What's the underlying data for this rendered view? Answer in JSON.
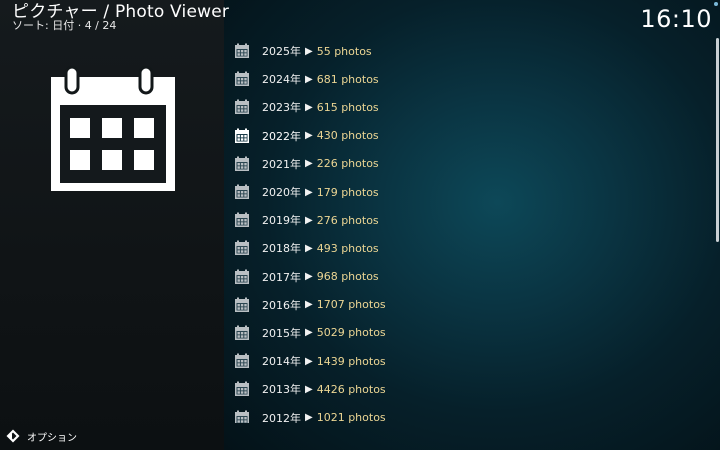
{
  "header": {
    "title": "ピクチャー / Photo Viewer",
    "subtitle": "ソート: 日付 · 4 / 24",
    "clock": "16:10"
  },
  "years": [
    {
      "year": "2025年",
      "arrow": "▶",
      "count": "55 photos"
    },
    {
      "year": "2024年",
      "arrow": "▶",
      "count": "681 photos"
    },
    {
      "year": "2023年",
      "arrow": "▶",
      "count": "615 photos"
    },
    {
      "year": "2022年",
      "arrow": "▶",
      "count": "430 photos",
      "selected": true
    },
    {
      "year": "2021年",
      "arrow": "▶",
      "count": "226 photos"
    },
    {
      "year": "2020年",
      "arrow": "▶",
      "count": "179 photos"
    },
    {
      "year": "2019年",
      "arrow": "▶",
      "count": "276 photos"
    },
    {
      "year": "2018年",
      "arrow": "▶",
      "count": "493 photos"
    },
    {
      "year": "2017年",
      "arrow": "▶",
      "count": "968 photos"
    },
    {
      "year": "2016年",
      "arrow": "▶",
      "count": "1707 photos"
    },
    {
      "year": "2015年",
      "arrow": "▶",
      "count": "5029 photos"
    },
    {
      "year": "2014年",
      "arrow": "▶",
      "count": "1439 photos"
    },
    {
      "year": "2013年",
      "arrow": "▶",
      "count": "4426 photos"
    },
    {
      "year": "2012年",
      "arrow": "▶",
      "count": "1021 photos"
    }
  ],
  "footer": {
    "options_label": "オプション"
  },
  "icons": {
    "big": "calendar-icon",
    "row": "calendar-icon",
    "footer": "options-icon"
  },
  "colors": {
    "count_text": "#ecd694",
    "selected_icon": "#ffffff",
    "row_icon": "#b9bfc3"
  }
}
